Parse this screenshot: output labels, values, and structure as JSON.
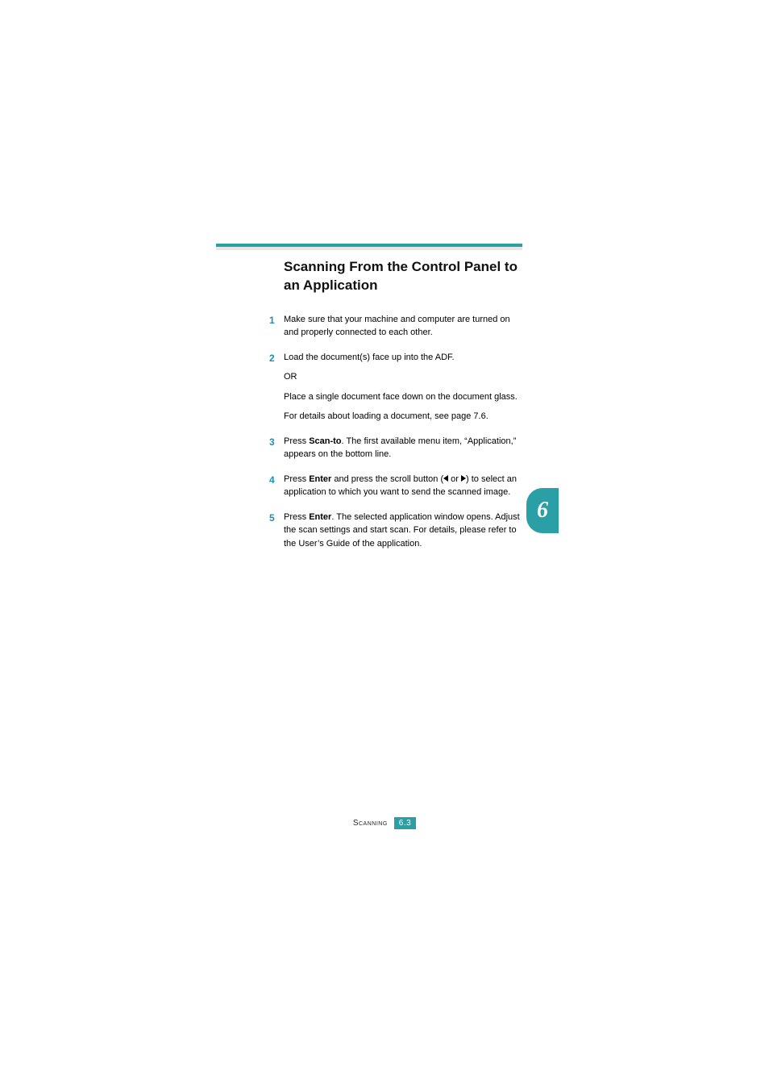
{
  "heading": "Scanning From the Control Panel to an Application",
  "steps": [
    {
      "n": "1",
      "paras": [
        {
          "runs": [
            {
              "t": "Make sure that your machine and computer are turned on and properly connected to each other."
            }
          ]
        }
      ]
    },
    {
      "n": "2",
      "paras": [
        {
          "runs": [
            {
              "t": "Load the document(s) face up into the ADF."
            }
          ]
        },
        {
          "runs": [
            {
              "t": "OR"
            }
          ]
        },
        {
          "runs": [
            {
              "t": "Place a single document face down on the document glass."
            }
          ]
        },
        {
          "runs": [
            {
              "t": "For details about loading a document, see page 7.6."
            }
          ]
        }
      ]
    },
    {
      "n": "3",
      "paras": [
        {
          "runs": [
            {
              "t": "Press "
            },
            {
              "t": "Scan-to",
              "b": true
            },
            {
              "t": ". The first available menu item, “Application,” appears on the bottom line."
            }
          ]
        }
      ]
    },
    {
      "n": "4",
      "paras": [
        {
          "runs": [
            {
              "t": "Press "
            },
            {
              "t": "Enter",
              "b": true
            },
            {
              "t": " and press the scroll button ("
            },
            {
              "icon": "left"
            },
            {
              "t": " or "
            },
            {
              "icon": "right"
            },
            {
              "t": ") to select an application to which you want to send the scanned image."
            }
          ]
        }
      ]
    },
    {
      "n": "5",
      "paras": [
        {
          "runs": [
            {
              "t": "Press "
            },
            {
              "t": "Enter",
              "b": true
            },
            {
              "t": ". The selected application window opens. Adjust the scan settings and start scan. For details, please refer to the User’s Guide of the application."
            }
          ]
        }
      ]
    }
  ],
  "side_tab": "6",
  "footer": {
    "label": "Scanning",
    "page": "6.3"
  }
}
